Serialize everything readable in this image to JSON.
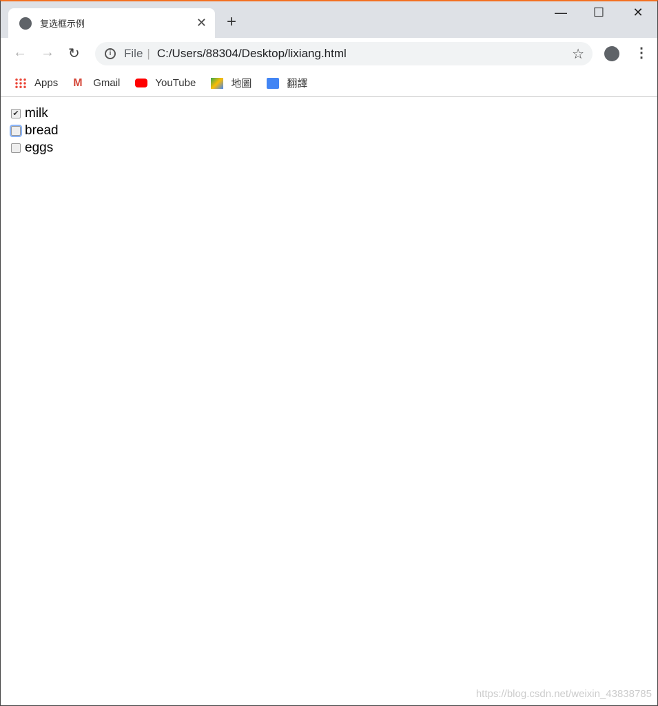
{
  "tab": {
    "title": "复选框示例",
    "close": "✕",
    "new_tab": "+"
  },
  "window": {
    "minimize": "—",
    "maximize": "☐",
    "close": "✕"
  },
  "toolbar": {
    "back": "←",
    "forward": "→",
    "reload": "↻",
    "scheme": "File",
    "url": "C:/Users/88304/Desktop/lixiang.html",
    "star": "☆",
    "menu": "⋮"
  },
  "bookmarks": [
    {
      "label": "Apps",
      "icon": "apps-grid-icon"
    },
    {
      "label": "Gmail",
      "icon": "gmail-icon"
    },
    {
      "label": "YouTube",
      "icon": "youtube-icon"
    },
    {
      "label": "地圖",
      "icon": "maps-icon"
    },
    {
      "label": "翻譯",
      "icon": "translate-icon"
    }
  ],
  "checkboxes": [
    {
      "label": "milk",
      "checked": true
    },
    {
      "label": "bread",
      "checked": false,
      "focused": true
    },
    {
      "label": "eggs",
      "checked": false
    }
  ],
  "watermark": "https://blog.csdn.net/weixin_43838785"
}
